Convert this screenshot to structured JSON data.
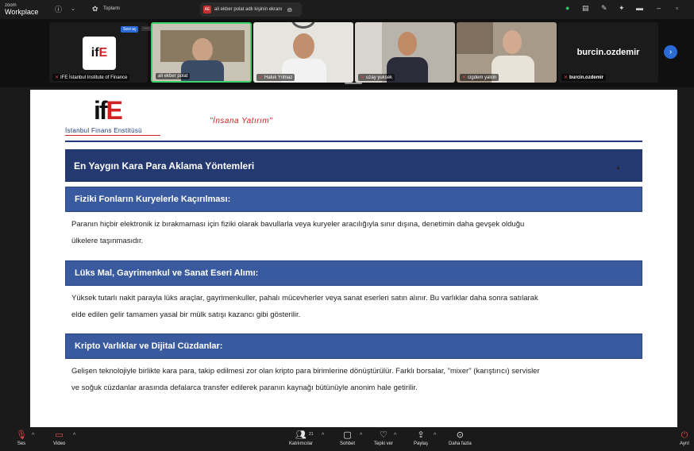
{
  "topbar": {
    "brand_line1": "zoom",
    "brand_line2": "Workplace",
    "info_icon": "info-icon",
    "meetings_label": "Toplantı",
    "meeting_tab_badge": "AE",
    "meeting_tab_title": "ali ekber polat adlı kişinin ekranı"
  },
  "gallery": {
    "tiles": [
      {
        "name": "IFE İstanbul Institute of Finance"
      },
      {
        "name": "ali ekber polat"
      },
      {
        "name": "Haluk Yılmaz"
      },
      {
        "name": "uzay yuksek"
      },
      {
        "name": "cigdem yalcin"
      },
      {
        "name": "burcin.ozdemir"
      }
    ],
    "sesi_ac_label": "Sesi aç",
    "more_label": "···",
    "big_name": "burcin.ozdemir",
    "ife_logo_left": "if",
    "ife_logo_right": "E"
  },
  "slide": {
    "logo_left": "if",
    "logo_right": "E",
    "logo_subtitle": "İstanbul Finans Enstitüsü",
    "slogan": "\"İnsana Yatırım\"",
    "title": "En Yaygın Kara Para Aklama Yöntemleri",
    "sections": [
      {
        "heading": "Fiziki Fonların Kuryelerle Kaçırılması:",
        "line1": "Paranın hiçbir elektronik iz bırakmaması için fiziki olarak bavullarla veya kuryeler aracılığıyla sınır dışına, denetimin daha gevşek olduğu",
        "line2": "ülkelere taşınmasıdır."
      },
      {
        "heading": "Lüks Mal, Gayrimenkul ve Sanat Eseri Alımı:",
        "line1": "Yüksek tutarlı nakit parayla lüks araçlar, gayrimenkuller, pahalı mücevherler veya sanat eserleri satın alınır. Bu varlıklar daha sonra satılarak",
        "line2": "elde edilen gelir tamamen yasal bir mülk satışı kazancı gibi gösterilir."
      },
      {
        "heading": "Kripto Varlıklar ve Dijital Cüzdanlar:",
        "line1": "Gelişen teknolojiyle birlikte kara para, takip edilmesi zor olan kripto para birimlerine dönüştürülür. Farklı borsalar, \"mixer\" (karıştırıcı) servisler",
        "line2": "ve soğuk cüzdanlar arasında defalarca transfer edilerek paranın kaynağı bütünüyle anonim hale getirilir."
      }
    ]
  },
  "bottombar": {
    "audio_label": "Ses",
    "video_label": "Video",
    "participants_label": "Katılımcılar",
    "participants_count": "21",
    "chat_label": "Sohbet",
    "react_label": "Tepki ver",
    "share_label": "Paylaş",
    "more_label": "Daha fazla",
    "leave_label": "Ayrıl"
  }
}
